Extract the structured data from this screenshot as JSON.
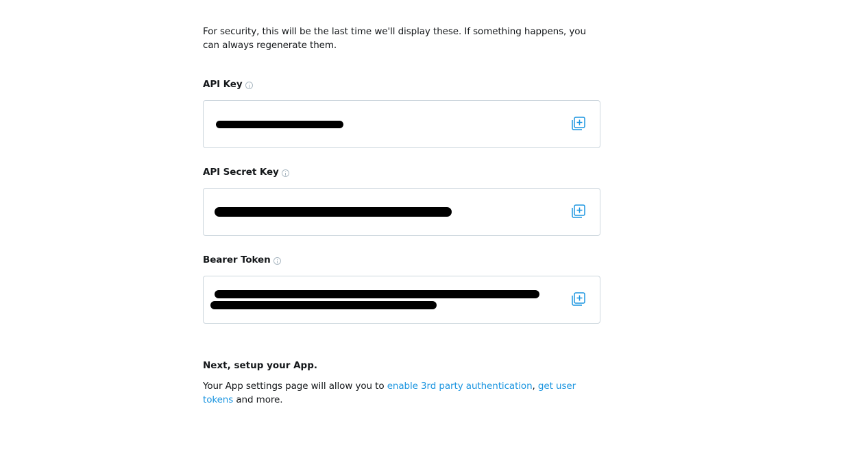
{
  "intro_text": "For security, this will be the last time we'll display these. If something happens, you can always regenerate them.",
  "fields": [
    {
      "label": "API Key",
      "value": "",
      "info_icon": "info-icon",
      "copy_icon": "copy-icon"
    },
    {
      "label": "API Secret Key",
      "value": "",
      "info_icon": "info-icon",
      "copy_icon": "copy-icon"
    },
    {
      "label": "Bearer Token",
      "value": "",
      "info_icon": "info-icon",
      "copy_icon": "copy-icon"
    }
  ],
  "next": {
    "title": "Next, setup your App.",
    "text_before": "Your App settings page will allow you to ",
    "link1": "enable 3rd party authentication",
    "separator": ", ",
    "link2": "get user tokens",
    "text_after": " and more."
  },
  "colors": {
    "link": "#1b95e0",
    "border": "#ccd6dd",
    "icon_blue": "#1b95e0",
    "redaction": "#000000"
  }
}
